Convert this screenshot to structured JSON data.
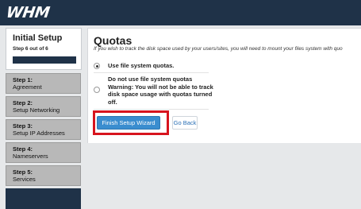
{
  "header": {
    "logo_text": "WHM",
    "bg_color": "#1f3248"
  },
  "sidebar": {
    "title": "Initial Setup",
    "step_indicator": "Step 6 out of 6",
    "progress_fraction": 1.0,
    "steps": [
      {
        "number": "Step 1:",
        "name": "Agreement"
      },
      {
        "number": "Step 2:",
        "name": "Setup Networking"
      },
      {
        "number": "Step 3:",
        "name": "Setup IP Addresses"
      },
      {
        "number": "Step 4:",
        "name": "Nameservers"
      },
      {
        "number": "Step 5:",
        "name": "Services"
      }
    ]
  },
  "main": {
    "title": "Quotas",
    "description": "If you wish to track the disk space used by your users/sites, you will need to mount your files system with quo",
    "options": [
      {
        "label": "Use file system quotas.",
        "checked": true
      },
      {
        "label": "Do not use file system quotas Warning: You will not be able to track disk space usage with quotas turned off.",
        "checked": false
      }
    ],
    "finish_button": "Finish Setup Wizard",
    "back_button": "Go Back"
  },
  "colors": {
    "accent": "#3a8dcf",
    "highlight": "#d7141e",
    "step_bg": "#b8b8b8"
  }
}
